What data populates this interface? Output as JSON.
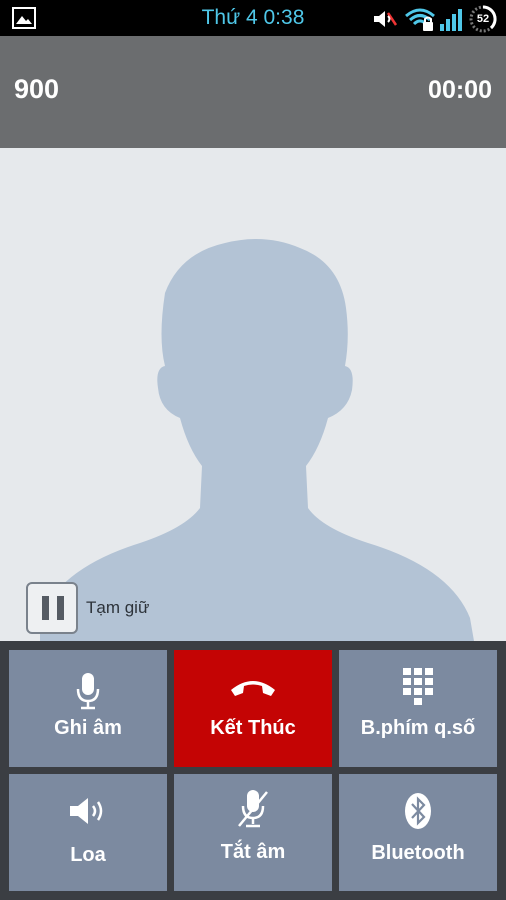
{
  "status_bar": {
    "time": "Thứ 4 0:38",
    "battery_level": "52",
    "icons": [
      "gallery-icon",
      "muted-sound-icon",
      "wifi-locked-icon",
      "signal-icon",
      "battery-icon"
    ],
    "clock_color": "#4fc7e8"
  },
  "call": {
    "number": "900",
    "duration": "00:00"
  },
  "hold": {
    "label": "Tạm giữ"
  },
  "controls": {
    "record": "Ghi âm",
    "end_call": "Kết Thúc",
    "dialpad": "B.phím q.số",
    "speaker": "Loa",
    "mute": "Tắt âm",
    "bluetooth": "Bluetooth"
  },
  "colors": {
    "end_call": "#c40404",
    "control_button": "#7c8aa0",
    "header": "#6b6d6f"
  }
}
